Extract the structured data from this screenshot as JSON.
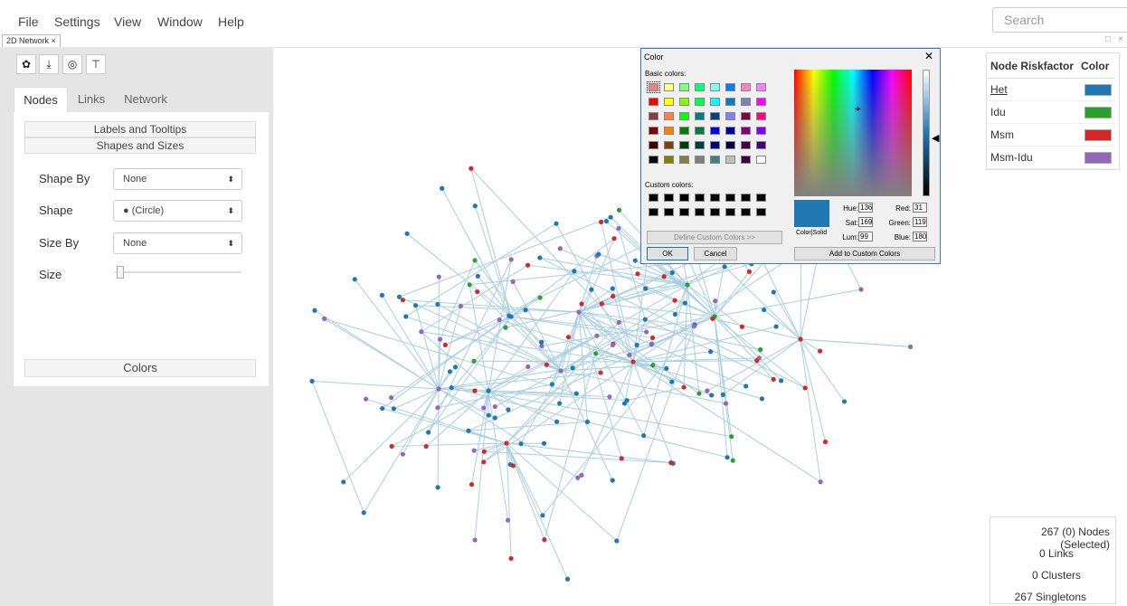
{
  "menu": [
    "File",
    "Settings",
    "View",
    "Window",
    "Help"
  ],
  "search": {
    "placeholder": "Search"
  },
  "document_tab": {
    "label": "2D Network",
    "close": "×"
  },
  "window_controls": {
    "maximize": "□",
    "close": "×"
  },
  "toolbar_icons": [
    "gear-icon",
    "download-icon",
    "target-icon",
    "pin-icon"
  ],
  "toolbar_glyphs": [
    "✿",
    "⤓",
    "◎",
    "⊤"
  ],
  "tabs": [
    "Nodes",
    "Links",
    "Network"
  ],
  "active_tab": "Nodes",
  "sections": {
    "labels": "Labels and Tooltips",
    "shapes": "Shapes and Sizes",
    "colors": "Colors"
  },
  "fields": {
    "shape_by": {
      "label": "Shape By",
      "value": "None"
    },
    "shape": {
      "label": "Shape",
      "value": "● (Circle)"
    },
    "size_by": {
      "label": "Size By",
      "value": "None"
    },
    "size": {
      "label": "Size",
      "level": 0.05
    }
  },
  "color_dialog": {
    "title": "Color",
    "basic_colors_label": "Basic colors:",
    "custom_colors_label": "Custom colors:",
    "define_button": "Define Custom Colors >>",
    "ok": "OK",
    "cancel": "Cancel",
    "add_button": "Add to Custom Colors",
    "color_solid_label": "Color|Solid",
    "hue": {
      "label": "Hue:",
      "value": "136"
    },
    "sat": {
      "label": "Sat:",
      "value": "169"
    },
    "lum": {
      "label": "Lum:",
      "value": "99"
    },
    "red": {
      "label": "Red:",
      "value": "31"
    },
    "green": {
      "label": "Green:",
      "value": "119"
    },
    "blue": {
      "label": "Blue:",
      "value": "180"
    },
    "preview_color": "#1f77b4",
    "basic_colors": [
      [
        "#f08080",
        "#ffff80",
        "#80ff80",
        "#00ff80",
        "#80ffff",
        "#0080ff",
        "#ff80c0",
        "#ff80ff"
      ],
      [
        "#ff0000",
        "#ffff00",
        "#80ff00",
        "#00ff40",
        "#00ffff",
        "#0080c0",
        "#8080c0",
        "#ff00ff"
      ],
      [
        "#804040",
        "#ff8040",
        "#00ff00",
        "#008080",
        "#004080",
        "#8080ff",
        "#800040",
        "#ff0080"
      ],
      [
        "#800000",
        "#ff8000",
        "#008000",
        "#008040",
        "#0000ff",
        "#0000a0",
        "#800080",
        "#8000ff"
      ],
      [
        "#400000",
        "#804000",
        "#004000",
        "#004040",
        "#000080",
        "#000040",
        "#400040",
        "#400080"
      ],
      [
        "#000000",
        "#808000",
        "#808040",
        "#808080",
        "#408080",
        "#c0c0c0",
        "#400040",
        "#ffffff"
      ]
    ]
  },
  "legend": {
    "header_name": "Node Riskfactor",
    "header_color": "Color",
    "rows": [
      {
        "name": "Het",
        "color": "#1f77b4"
      },
      {
        "name": "Idu",
        "color": "#2ca02c"
      },
      {
        "name": "Msm",
        "color": "#d62728"
      },
      {
        "name": "Msm-Idu",
        "color": "#9467bd"
      }
    ]
  },
  "stats": {
    "nodes": "267 (0) Nodes (Selected)",
    "links": "0 Links",
    "clusters": "0 Clusters",
    "singletons": "267 Singletons"
  }
}
